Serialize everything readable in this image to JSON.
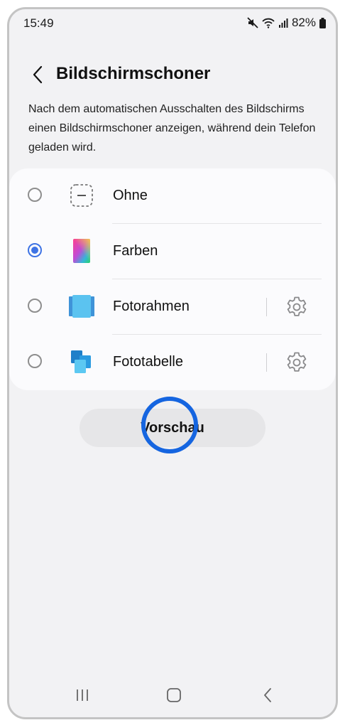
{
  "status_bar": {
    "time": "15:49",
    "battery_percent": "82%",
    "icons": [
      "mute-icon",
      "wifi-icon",
      "signal-icon",
      "battery-icon"
    ]
  },
  "header": {
    "back_icon": "chevron-left-icon",
    "title": "Bildschirmschoner"
  },
  "description": "Nach dem automatischen Ausschalten des Bildschirms einen Bildschirmschoner anzeigen, während dein Telefon geladen wird.",
  "options": [
    {
      "label": "Ohne",
      "selected": false,
      "icon": "none-icon",
      "has_settings": false
    },
    {
      "label": "Farben",
      "selected": true,
      "icon": "colors-icon",
      "has_settings": false
    },
    {
      "label": "Fotorahmen",
      "selected": false,
      "icon": "photo-frame-icon",
      "has_settings": true
    },
    {
      "label": "Fototabelle",
      "selected": false,
      "icon": "photo-table-icon",
      "has_settings": true
    }
  ],
  "preview_button": {
    "label": "Vorschau"
  },
  "colors": {
    "accent": "#3e73e4",
    "tap_indicator": "#1565e0",
    "background": "#f2f2f4",
    "card": "#fbfbfd"
  },
  "nav_bar": {
    "icons": [
      "recents-icon",
      "home-icon",
      "back-icon"
    ]
  }
}
